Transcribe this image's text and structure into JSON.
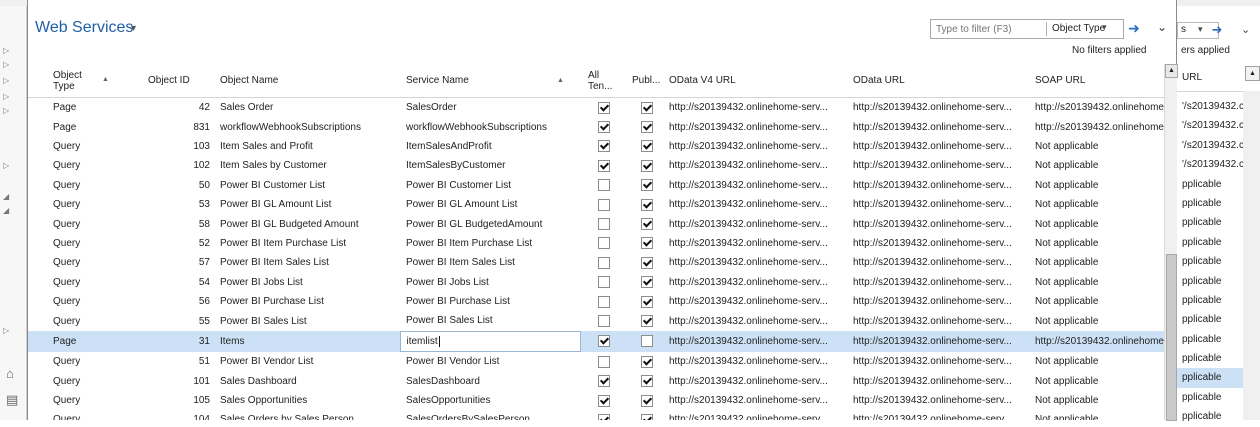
{
  "dialog": {
    "title": "Web Services",
    "filter": {
      "placeholder": "Type to filter (F3)",
      "type_label": "Object Type",
      "no_filters": "No filters applied"
    },
    "columns": {
      "object_type": "Object Type",
      "object_id": "Object ID",
      "object_name": "Object Name",
      "service_name": "Service Name",
      "all_tenants": "All Ten...",
      "published": "Publ...",
      "odata_v4_url": "OData V4 URL",
      "odata_url": "OData URL",
      "soap_url": "SOAP URL"
    },
    "rows": [
      {
        "type": "Page",
        "id": "42",
        "name": "Sales Order",
        "service": "SalesOrder",
        "all": true,
        "pub": true,
        "o4": "http://s20139432.onlinehome-serv...",
        "od": "http://s20139432.onlinehome-serv...",
        "soap": "http://s20139432.onlinehome-serv..."
      },
      {
        "type": "Page",
        "id": "831",
        "name": "workflowWebhookSubscriptions",
        "service": "workflowWebhookSubscriptions",
        "all": true,
        "pub": true,
        "o4": "http://s20139432.onlinehome-serv...",
        "od": "http://s20139432.onlinehome-serv...",
        "soap": "http://s20139432.onlinehome-serv..."
      },
      {
        "type": "Query",
        "id": "103",
        "name": "Item Sales and Profit",
        "service": "ItemSalesAndProfit",
        "all": true,
        "pub": true,
        "o4": "http://s20139432.onlinehome-serv...",
        "od": "http://s20139432.onlinehome-serv...",
        "soap": "Not applicable"
      },
      {
        "type": "Query",
        "id": "102",
        "name": "Item Sales by Customer",
        "service": "ItemSalesByCustomer",
        "all": true,
        "pub": true,
        "o4": "http://s20139432.onlinehome-serv...",
        "od": "http://s20139432.onlinehome-serv...",
        "soap": "Not applicable"
      },
      {
        "type": "Query",
        "id": "50",
        "name": "Power BI Customer List",
        "service": "Power BI Customer List",
        "all": false,
        "pub": true,
        "o4": "http://s20139432.onlinehome-serv...",
        "od": "http://s20139432.onlinehome-serv...",
        "soap": "Not applicable"
      },
      {
        "type": "Query",
        "id": "53",
        "name": "Power BI GL Amount List",
        "service": "Power BI GL Amount List",
        "all": false,
        "pub": true,
        "o4": "http://s20139432.onlinehome-serv...",
        "od": "http://s20139432.onlinehome-serv...",
        "soap": "Not applicable"
      },
      {
        "type": "Query",
        "id": "58",
        "name": "Power BI GL Budgeted Amount",
        "service": "Power BI GL BudgetedAmount",
        "all": false,
        "pub": true,
        "o4": "http://s20139432.onlinehome-serv...",
        "od": "http://s20139432.onlinehome-serv...",
        "soap": "Not applicable"
      },
      {
        "type": "Query",
        "id": "52",
        "name": "Power BI Item Purchase List",
        "service": "Power BI Item Purchase List",
        "all": false,
        "pub": true,
        "o4": "http://s20139432.onlinehome-serv...",
        "od": "http://s20139432.onlinehome-serv...",
        "soap": "Not applicable"
      },
      {
        "type": "Query",
        "id": "57",
        "name": "Power BI Item Sales List",
        "service": "Power BI Item Sales List",
        "all": false,
        "pub": true,
        "o4": "http://s20139432.onlinehome-serv...",
        "od": "http://s20139432.onlinehome-serv...",
        "soap": "Not applicable"
      },
      {
        "type": "Query",
        "id": "54",
        "name": "Power BI Jobs List",
        "service": "Power BI Jobs List",
        "all": false,
        "pub": true,
        "o4": "http://s20139432.onlinehome-serv...",
        "od": "http://s20139432.onlinehome-serv...",
        "soap": "Not applicable"
      },
      {
        "type": "Query",
        "id": "56",
        "name": "Power BI Purchase List",
        "service": "Power BI Purchase List",
        "all": false,
        "pub": true,
        "o4": "http://s20139432.onlinehome-serv...",
        "od": "http://s20139432.onlinehome-serv...",
        "soap": "Not applicable"
      },
      {
        "type": "Query",
        "id": "55",
        "name": "Power BI Sales List",
        "service": "Power BI Sales List",
        "all": false,
        "pub": true,
        "o4": "http://s20139432.onlinehome-serv...",
        "od": "http://s20139432.onlinehome-serv...",
        "soap": "Not applicable"
      },
      {
        "type": "Page",
        "id": "31",
        "name": "Items",
        "service": "itemlist",
        "all": true,
        "pub": false,
        "o4": "http://s20139432.onlinehome-serv...",
        "od": "http://s20139432.onlinehome-serv...",
        "soap": "http://s20139432.onlinehome-serv...",
        "selected": true
      },
      {
        "type": "Query",
        "id": "51",
        "name": "Power BI Vendor List",
        "service": "Power BI Vendor List",
        "all": false,
        "pub": true,
        "o4": "http://s20139432.onlinehome-serv...",
        "od": "http://s20139432.onlinehome-serv...",
        "soap": "Not applicable"
      },
      {
        "type": "Query",
        "id": "101",
        "name": "Sales Dashboard",
        "service": "SalesDashboard",
        "all": true,
        "pub": true,
        "o4": "http://s20139432.onlinehome-serv...",
        "od": "http://s20139432.onlinehome-serv...",
        "soap": "Not applicable"
      },
      {
        "type": "Query",
        "id": "105",
        "name": "Sales Opportunities",
        "service": "SalesOpportunities",
        "all": true,
        "pub": true,
        "o4": "http://s20139432.onlinehome-serv...",
        "od": "http://s20139432.onlinehome-serv...",
        "soap": "Not applicable"
      },
      {
        "type": "Query",
        "id": "104",
        "name": "Sales Orders by Sales Person",
        "service": "SalesOrdersBySalesPerson",
        "all": true,
        "pub": true,
        "o4": "http://s20139432.onlinehome-serv...",
        "od": "http://s20139432.onlinehome-serv...",
        "soap": "Not applicable"
      }
    ]
  },
  "background_window": {
    "filter_fragment": "s",
    "no_filters_fragment": "ers applied",
    "url_header": "URL",
    "cells": [
      "'/s20139432.c",
      "'/s20139432.c",
      "'/s20139432.c",
      "'/s20139432.c",
      "pplicable",
      "pplicable",
      "pplicable",
      "pplicable",
      "pplicable",
      "pplicable",
      "pplicable",
      "pplicable",
      "pplicable",
      "pplicable",
      "pplicable",
      "pplicable",
      "pplicable"
    ]
  },
  "colors": {
    "title": "#1f5fa9",
    "selected_row": "#cce1f5",
    "accent_arrow": "#2a6ebd"
  }
}
